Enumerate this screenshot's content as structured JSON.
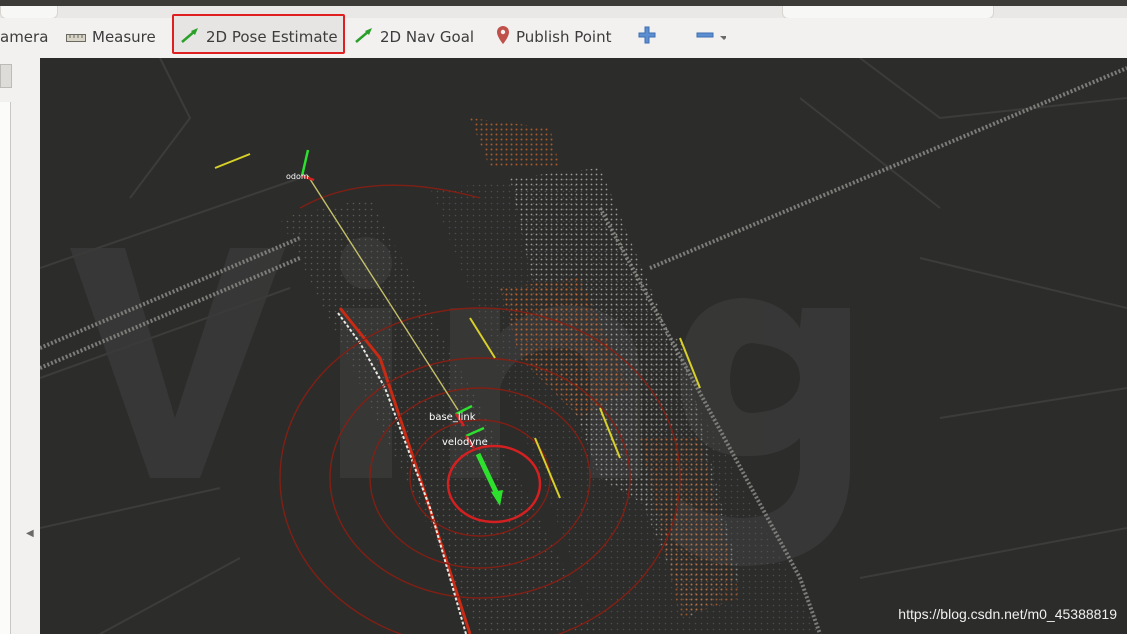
{
  "toolbar": {
    "items": [
      {
        "label": "amera",
        "icon": "camera-icon"
      },
      {
        "label": "Measure",
        "icon": "ruler-icon"
      },
      {
        "label": "2D Pose Estimate",
        "icon": "green-arrow-icon",
        "highlighted": true
      },
      {
        "label": "2D Nav Goal",
        "icon": "green-arrow-icon"
      },
      {
        "label": "Publish Point",
        "icon": "map-pin-icon"
      },
      {
        "label": "",
        "icon": "plus-icon"
      },
      {
        "label": "",
        "icon": "minus-icon"
      }
    ],
    "highlight_color": "#e02020"
  },
  "viewport": {
    "frames": {
      "base_link": "base_link",
      "velodyne": "velodyne",
      "odom": "odom"
    },
    "background_color": "#2c2c2b",
    "annotation_color": "#d42020",
    "arrow_color": "#2ee02e"
  },
  "watermark": "https://blog.csdn.net/m0_45388819"
}
